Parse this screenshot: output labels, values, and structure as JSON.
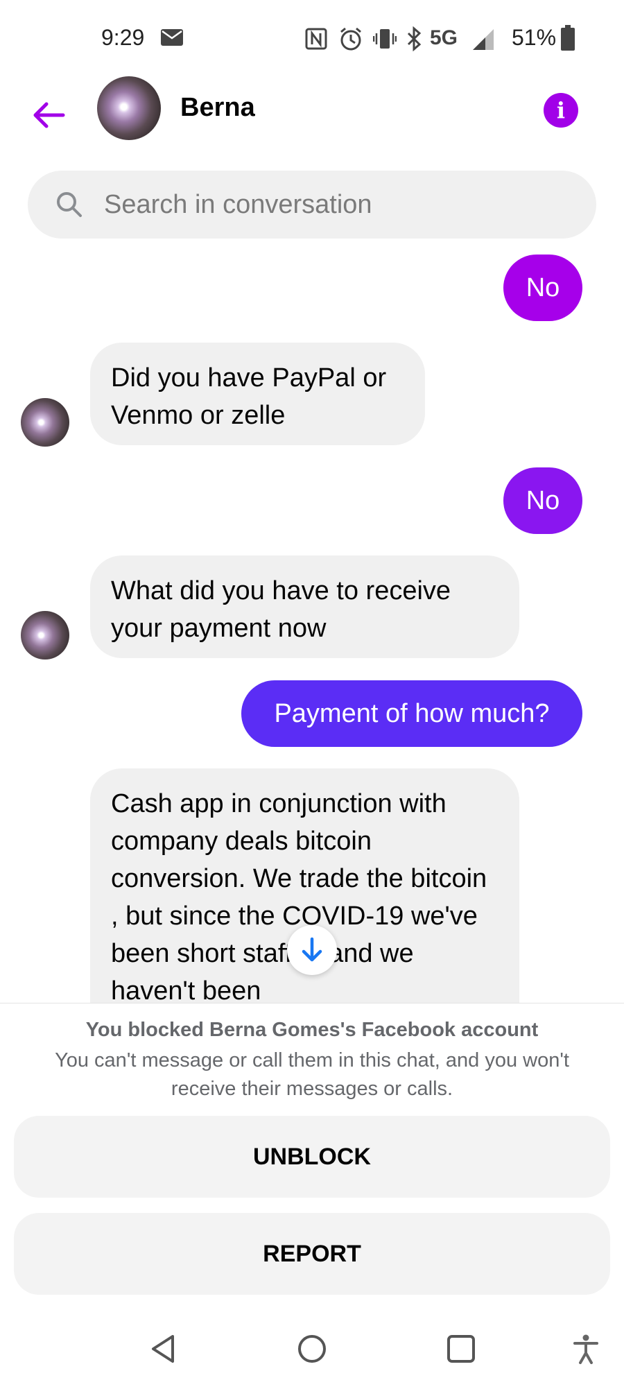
{
  "status_bar": {
    "time": "9:29",
    "network": "5G",
    "battery": "51%",
    "icons": [
      "mail-icon",
      "nfc-icon",
      "alarm-icon",
      "vibrate-icon",
      "bluetooth-icon",
      "signal-icon",
      "battery-icon"
    ]
  },
  "header": {
    "contact_name": "Berna",
    "accent_color": "#a100e8"
  },
  "search": {
    "placeholder": "Search in conversation"
  },
  "messages": [
    {
      "direction": "outgoing",
      "text": "No"
    },
    {
      "direction": "incoming",
      "text": "Did you have PayPal or Venmo or zelle"
    },
    {
      "direction": "outgoing",
      "text": "No"
    },
    {
      "direction": "incoming",
      "text": "What did you have to receive your payment now"
    },
    {
      "direction": "outgoing",
      "text": "Payment of how much?"
    },
    {
      "direction": "incoming",
      "text": "Cash app in conjunction with company deals bitcoin conversion. We trade the bitcoin , but since the COVID-19 we've been short staffed and we haven't been"
    }
  ],
  "blocked": {
    "title": "You blocked Berna Gomes's Facebook account",
    "description": "You can't message or call them in this chat, and you won't receive their messages or calls.",
    "unblock_label": "UNBLOCK",
    "report_label": "REPORT"
  },
  "colors": {
    "outgoing_top": "#a600ea",
    "outgoing_mid": "#8a16f0",
    "outgoing_bottom": "#5b2df5",
    "incoming_bg": "#f0f0f0"
  }
}
